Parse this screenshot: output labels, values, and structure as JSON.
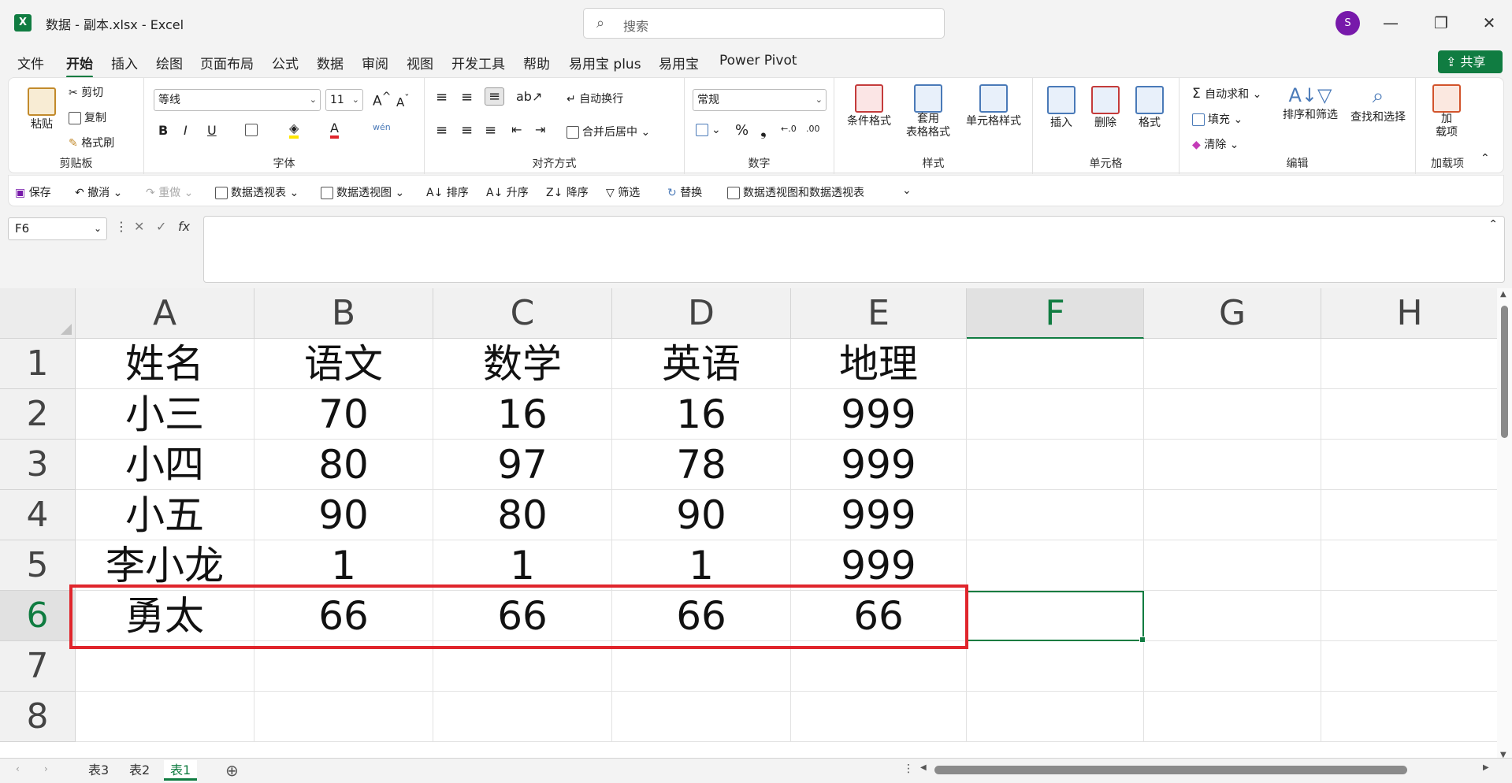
{
  "window": {
    "title": "数据 - 副本.xlsx  -  Excel",
    "app_icon": "X",
    "search_placeholder": "搜索",
    "avatar_initial": "S",
    "minimize": "—",
    "restore": "❐",
    "close": "✕"
  },
  "menu": {
    "tabs": [
      "文件",
      "开始",
      "插入",
      "绘图",
      "页面布局",
      "公式",
      "数据",
      "审阅",
      "视图",
      "开发工具",
      "帮助",
      "易用宝 plus",
      "易用宝",
      "Power Pivot"
    ],
    "active": "开始",
    "share": "共享"
  },
  "ribbon": {
    "clipboard": {
      "label": "剪贴板",
      "paste": "粘贴",
      "cut": "剪切",
      "copy": "复制",
      "format_painter": "格式刷"
    },
    "font": {
      "label": "字体",
      "name": "等线",
      "size": "11",
      "bold": "B",
      "italic": "I",
      "underline": "U"
    },
    "align": {
      "label": "对齐方式",
      "wrap": "自动换行",
      "merge": "合并后居中"
    },
    "number": {
      "label": "数字",
      "format": "常规",
      "percent": "%"
    },
    "styles": {
      "label": "样式",
      "cond": "条件格式",
      "table": "套用\n表格格式",
      "cell": "单元格样式"
    },
    "cells": {
      "label": "单元格",
      "insert": "插入",
      "delete": "删除",
      "format": "格式"
    },
    "edit": {
      "label": "编辑",
      "autosum": "自动求和",
      "fill": "填充",
      "clear": "清除",
      "sort": "排序和筛选",
      "find": "查找和选择"
    },
    "addins": {
      "label": "加载项",
      "addin": "加\n载项"
    }
  },
  "qat": {
    "save": "保存",
    "undo": "撤消",
    "redo": "重做",
    "pivot_table": "数据透视表",
    "pivot_chart": "数据透视图",
    "sort": "排序",
    "asc": "升序",
    "desc": "降序",
    "filter": "筛选",
    "replace": "替换",
    "pivot_both": "数据透视图和数据透视表"
  },
  "formula_bar": {
    "name_box": "F6",
    "fx": "fx",
    "value": ""
  },
  "grid": {
    "columns": [
      "A",
      "B",
      "C",
      "D",
      "E",
      "F",
      "G",
      "H"
    ],
    "selected_column": "F",
    "rows": [
      "1",
      "2",
      "3",
      "4",
      "5",
      "6",
      "7",
      "8"
    ],
    "selected_row": "6",
    "cells": [
      [
        "姓名",
        "语文",
        "数学",
        "英语",
        "地理"
      ],
      [
        "小三",
        "70",
        "16",
        "16",
        "999"
      ],
      [
        "小四",
        "80",
        "97",
        "78",
        "999"
      ],
      [
        "小五",
        "90",
        "80",
        "90",
        "999"
      ],
      [
        "李小龙",
        "1",
        "1",
        "1",
        "999"
      ],
      [
        "勇太",
        "66",
        "66",
        "66",
        "66"
      ],
      [
        "",
        "",
        "",
        "",
        ""
      ],
      [
        "",
        "",
        "",
        "",
        ""
      ]
    ],
    "highlight_color": "#e0252c",
    "accent_color": "#107c41"
  },
  "sheets": {
    "tabs": [
      "表3",
      "表2",
      "表1"
    ],
    "active": "表1",
    "add": "⊕"
  }
}
